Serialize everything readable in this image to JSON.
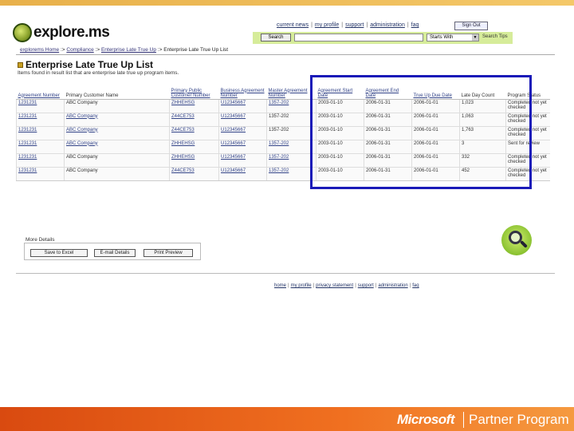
{
  "header": {
    "logo_text": "explore.ms",
    "nav": [
      "current news",
      "my profile",
      "support",
      "administration",
      "faq"
    ],
    "signout_label": "Sign Out"
  },
  "search": {
    "button_label": "Search",
    "input_value": "",
    "mode_selected": "Starts With",
    "tips_label": "Search Tips"
  },
  "breadcrumb": [
    "explorems Home",
    "Compliance",
    "Enterprise Late True Up",
    "Enterprise Late True Up List"
  ],
  "page": {
    "title": "Enterprise Late True Up List",
    "subtitle": "Items found in result list that are enterprise late true up program items."
  },
  "table": {
    "columns": [
      "Agreement Number",
      "Primary Customer Name",
      "Primary Public Customer Number",
      "Business Agreement Number",
      "Master Agreement Number",
      "Agreement Start Date",
      "Agreement End Date",
      "True Up Due Date",
      "Late Day Count",
      "Program Status"
    ],
    "rows": [
      [
        "1231231",
        "ABC Company",
        "ZHHEHSG",
        "U12345667",
        "1357-202",
        "2003-01-10",
        "2006-01-31",
        "2006-01-01",
        "1,023",
        "Completed not yet checked"
      ],
      [
        "1231231",
        "ABC Company",
        "Z44CE753",
        "U12345667",
        "1357-202",
        "2003-01-10",
        "2006-01-31",
        "2006-01-01",
        "1,063",
        "Completed not yet checked"
      ],
      [
        "1231231",
        "ABC Company",
        "Z44CE753",
        "U12345667",
        "1357-202",
        "2003-01-10",
        "2006-01-31",
        "2006-01-01",
        "1,763",
        "Completed not yet checked"
      ],
      [
        "1231231",
        "ABC Company",
        "ZHHEHSG",
        "U12345667",
        "1357-202",
        "2003-01-10",
        "2006-01-31",
        "2006-01-01",
        "3",
        "Sent for review"
      ],
      [
        "1231231",
        "ABC Company",
        "ZHHEHSG",
        "U12345667",
        "1357-202",
        "2003-01-10",
        "2006-01-31",
        "2006-01-01",
        "332",
        "Completed not yet checked"
      ],
      [
        "1231231",
        "ABC Company",
        "Z44CE753",
        "U12345667",
        "1357-202",
        "2003-01-10",
        "2006-01-31",
        "2006-01-01",
        "452",
        "Completed not yet checked"
      ]
    ]
  },
  "more_details": {
    "label": "More Details",
    "buttons": [
      "Save to Excel",
      "E-mail Details",
      "Print Preview"
    ]
  },
  "footer_nav": [
    "home",
    "my profile",
    "privacy statement",
    "support",
    "administration",
    "faq"
  ],
  "branding": {
    "company": "Microsoft",
    "program": "Partner Program"
  },
  "colors": {
    "highlight_border": "#1a1ab8",
    "search_bar_bg": "#d6ec9a",
    "bottom_band": "#f07020",
    "top_stripe": "#f4c869"
  },
  "icons": [
    "globe-logo-icon",
    "magnifier-icon",
    "page-title-icon"
  ]
}
